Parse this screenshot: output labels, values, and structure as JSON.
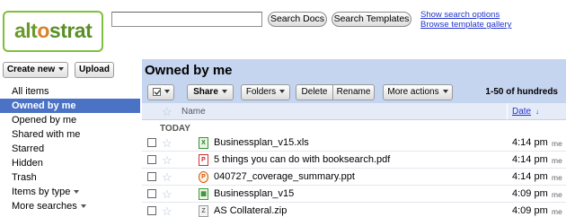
{
  "logo": {
    "part1": "alt",
    "part2": "o",
    "part3": "strat"
  },
  "search": {
    "value": "",
    "placeholder": ""
  },
  "header": {
    "search_docs_label": "Search Docs",
    "search_templates_label": "Search Templates",
    "show_search_options": "Show search options",
    "browse_template_gallery": "Browse template gallery"
  },
  "sidebar": {
    "create_new_label": "Create new",
    "upload_label": "Upload",
    "items": [
      {
        "label": "All items"
      },
      {
        "label": "Owned by me"
      },
      {
        "label": "Opened by me"
      },
      {
        "label": "Shared with me"
      },
      {
        "label": "Starred"
      },
      {
        "label": "Hidden"
      },
      {
        "label": "Trash"
      },
      {
        "label": "Items by type"
      },
      {
        "label": "More searches"
      }
    ]
  },
  "main": {
    "title": "Owned by me",
    "toolbar": {
      "share_label": "Share",
      "folders_label": "Folders",
      "delete_label": "Delete",
      "rename_label": "Rename",
      "more_actions_label": "More actions",
      "range_text": "1-50 of hundreds"
    },
    "columns": {
      "name": "Name",
      "date": "Date",
      "sort_indicator": "↓"
    },
    "group_label": "TODAY",
    "files": [
      {
        "icon": "excel-file-icon",
        "name": "Businessplan_v15.xls",
        "date": "4:14 pm",
        "owner": "me"
      },
      {
        "icon": "pdf-file-icon",
        "name": "5 things you can do with booksearch.pdf",
        "date": "4:14 pm",
        "owner": "me"
      },
      {
        "icon": "powerpoint-file-icon",
        "name": "040727_coverage_summary.ppt",
        "date": "4:14 pm",
        "owner": "me"
      },
      {
        "icon": "spreadsheet-file-icon",
        "name": "Businessplan_v15",
        "date": "4:09 pm",
        "owner": "me"
      },
      {
        "icon": "zip-file-icon",
        "name": "AS Collateral.zip",
        "date": "4:09 pm",
        "owner": "me"
      }
    ]
  },
  "colors": {
    "accent": "#4a72c5",
    "panel": "#c5d4ef",
    "link": "#2233cc",
    "logo_green": "#6a9a2c"
  }
}
